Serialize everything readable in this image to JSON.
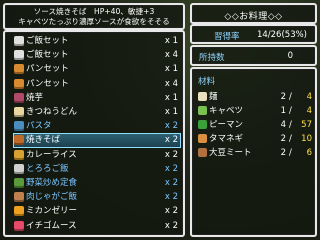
{
  "description": {
    "line1": "ソース焼きそば　HP+40、敏捷+3",
    "line2": "キャベツたっぷり濃厚ソースが食欲をそそる"
  },
  "title": "◇◇お料理◇◇",
  "mastery": {
    "label": "習得率",
    "value": "14/26(53%)"
  },
  "owned": {
    "label": "所持数",
    "value": "0"
  },
  "recipes": [
    {
      "name": "ご飯セット",
      "qty": "x 1",
      "icon": "rice-bowl-icon",
      "color": "#e0e0e0",
      "blue": false
    },
    {
      "name": "ご飯セット",
      "qty": "x 4",
      "icon": "rice-bowl-icon",
      "color": "#e0e0e0",
      "blue": false
    },
    {
      "name": "パンセット",
      "qty": "x 1",
      "icon": "bread-icon",
      "color": "#d88a30",
      "blue": false
    },
    {
      "name": "パンセット",
      "qty": "x 4",
      "icon": "bread-icon",
      "color": "#d88a30",
      "blue": false
    },
    {
      "name": "焼芋",
      "qty": "x 1",
      "icon": "sweet-potato-icon",
      "color": "#b04a6a",
      "blue": false
    },
    {
      "name": "きつねうどん",
      "qty": "x 1",
      "icon": "udon-icon",
      "color": "#e8d7a0",
      "blue": false
    },
    {
      "name": "パスタ",
      "qty": "x 2",
      "icon": "pasta-icon",
      "color": "#4a8ec0",
      "blue": true
    },
    {
      "name": "焼きそば",
      "qty": "x 2",
      "icon": "yakisoba-icon",
      "color": "#c06a2a",
      "blue": false,
      "selected": true
    },
    {
      "name": "カレーライス",
      "qty": "x 2",
      "icon": "curry-icon",
      "color": "#d8a030",
      "blue": false
    },
    {
      "name": "とろろご飯",
      "qty": "x 2",
      "icon": "tororo-rice-icon",
      "color": "#d0d0d0",
      "blue": true
    },
    {
      "name": "野菜炒め定食",
      "qty": "x 2",
      "icon": "stir-fry-icon",
      "color": "#5a9a3a",
      "blue": true
    },
    {
      "name": "肉じゃがご飯",
      "qty": "x 2",
      "icon": "nikujaga-icon",
      "color": "#c08050",
      "blue": true
    },
    {
      "name": "ミカンゼリー",
      "qty": "x 2",
      "icon": "orange-jelly-icon",
      "color": "#f0a020",
      "blue": false
    },
    {
      "name": "イチゴムース",
      "qty": "x 2",
      "icon": "strawberry-mousse-icon",
      "color": "#e84a6a",
      "blue": false
    }
  ],
  "materials": {
    "heading": "材料",
    "items": [
      {
        "name": "麺",
        "have": "2",
        "need": "4",
        "icon": "noodle-icon",
        "color": "#e8e0c0"
      },
      {
        "name": "キャベツ",
        "have": "1",
        "need": "4",
        "icon": "cabbage-icon",
        "color": "#7ac050"
      },
      {
        "name": "ピーマン",
        "have": "4",
        "need": "57",
        "icon": "pepper-icon",
        "color": "#3aa03a"
      },
      {
        "name": "タマネギ",
        "have": "2",
        "need": "10",
        "icon": "onion-icon",
        "color": "#d89040"
      },
      {
        "name": "大豆ミート",
        "have": "2",
        "need": "6",
        "icon": "soy-meat-icon",
        "color": "#b07040"
      }
    ]
  }
}
